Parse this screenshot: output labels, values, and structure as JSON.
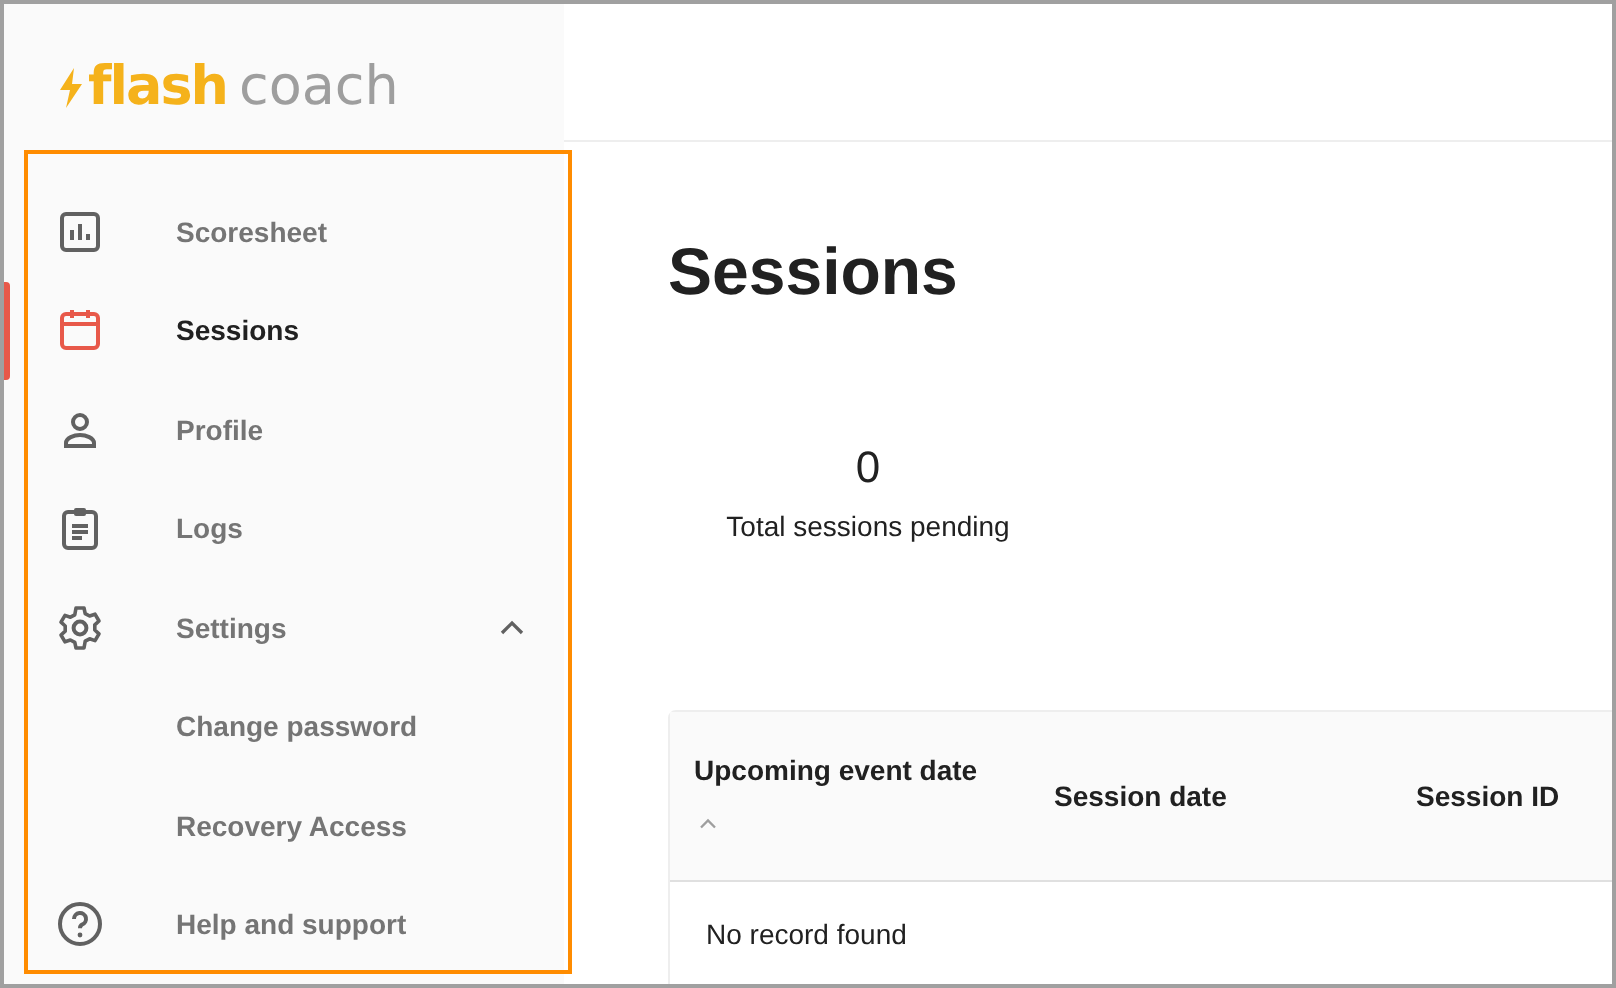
{
  "logo": {
    "part_1": "flash",
    "part_2": "coach"
  },
  "nav": [
    {
      "label": "Scoresheet",
      "selected": false
    },
    {
      "label": "Sessions",
      "selected": true
    },
    {
      "label": "Profile",
      "selected": false
    },
    {
      "label": "Logs",
      "selected": false
    },
    {
      "label": "Settings",
      "selected": false,
      "expanded": true,
      "children": [
        {
          "label": "Change password",
          "selected": false
        },
        {
          "label": "Recovery Access",
          "selected": false
        }
      ]
    },
    {
      "label": "Help and support",
      "selected": false
    }
  ],
  "page_title": "Sessions",
  "stat": {
    "value": "0",
    "label": "Total sessions pending"
  },
  "table": {
    "columns": [
      {
        "label": "Upcoming event date",
        "sorted": true
      },
      {
        "label": "Session date",
        "sorted": false
      },
      {
        "label": "Session ID",
        "sorted": false
      }
    ],
    "empty_message": "No record found"
  }
}
